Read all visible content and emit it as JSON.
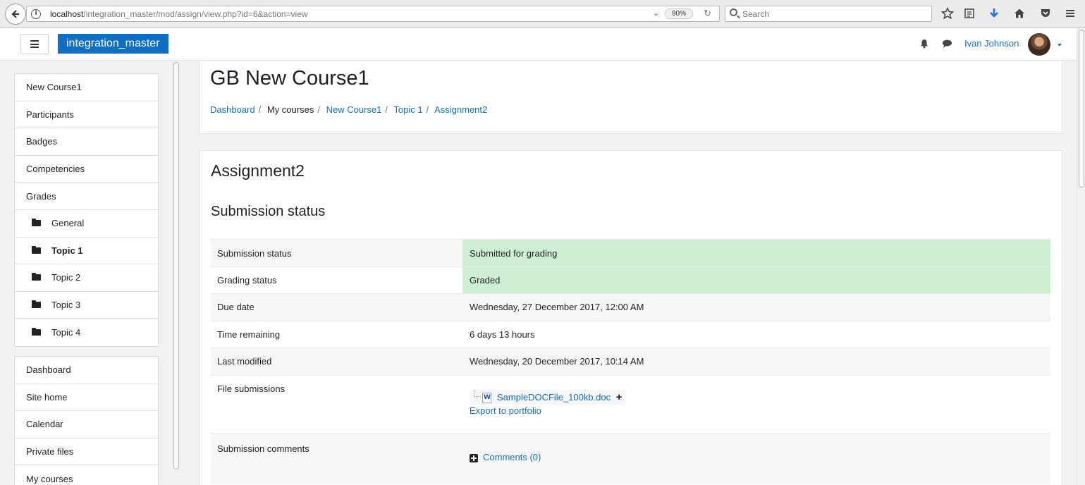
{
  "browser": {
    "url_host": "localhost",
    "url_path": "/integration_master/mod/assign/view.php?id=6&action=view",
    "zoom": "90%",
    "search_placeholder": "Search"
  },
  "navbar": {
    "site_name": "integration_master",
    "user_name": "Ivan Johnson"
  },
  "sidebar": {
    "course_block": [
      {
        "label": "New Course1"
      },
      {
        "label": "Participants"
      },
      {
        "label": "Badges"
      },
      {
        "label": "Competencies"
      },
      {
        "label": "Grades"
      },
      {
        "label": "General"
      },
      {
        "label": "Topic 1"
      },
      {
        "label": "Topic 2"
      },
      {
        "label": "Topic 3"
      },
      {
        "label": "Topic 4"
      }
    ],
    "site_block": [
      {
        "label": "Dashboard"
      },
      {
        "label": "Site home"
      },
      {
        "label": "Calendar"
      },
      {
        "label": "Private files"
      },
      {
        "label": "My courses"
      }
    ]
  },
  "header": {
    "course_title": "GB New Course1",
    "breadcrumb": [
      "Dashboard",
      "My courses",
      "New Course1",
      "Topic 1",
      "Assignment2"
    ]
  },
  "main": {
    "assignment_title": "Assignment2",
    "section_title": "Submission status",
    "rows": [
      {
        "label": "Submission status",
        "value": "Submitted for grading"
      },
      {
        "label": "Grading status",
        "value": "Graded"
      },
      {
        "label": "Due date",
        "value": "Wednesday, 27 December 2017, 12:00 AM"
      },
      {
        "label": "Time remaining",
        "value": "6 days 13 hours"
      },
      {
        "label": "Last modified",
        "value": "Wednesday, 20 December 2017, 10:14 AM"
      },
      {
        "label": "File submissions",
        "file_name": "SampleDOCFile_100kb.doc",
        "export_link": "Export to portfolio"
      },
      {
        "label": "Submission comments",
        "comments_link": "Comments (0)"
      }
    ]
  },
  "colors": {
    "brand": "#0f6fc5",
    "status_green": "#cfefd3"
  }
}
